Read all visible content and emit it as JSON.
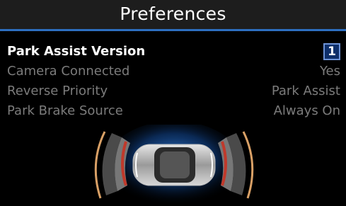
{
  "header": {
    "title": "Preferences"
  },
  "settings": [
    {
      "label": "Park Assist Version",
      "value": "1",
      "selected": true
    },
    {
      "label": "Camera Connected",
      "value": "Yes",
      "selected": false
    },
    {
      "label": "Reverse Priority",
      "value": "Park Assist",
      "selected": false
    },
    {
      "label": "Park Brake Source",
      "value": "Always On",
      "selected": false
    }
  ],
  "colors": {
    "accent": "#2d6fc0",
    "selected_bg": "#0e2f6a",
    "dim_text": "#7b7b7b"
  },
  "graphic": {
    "icon": "park-assist-car-icon"
  }
}
